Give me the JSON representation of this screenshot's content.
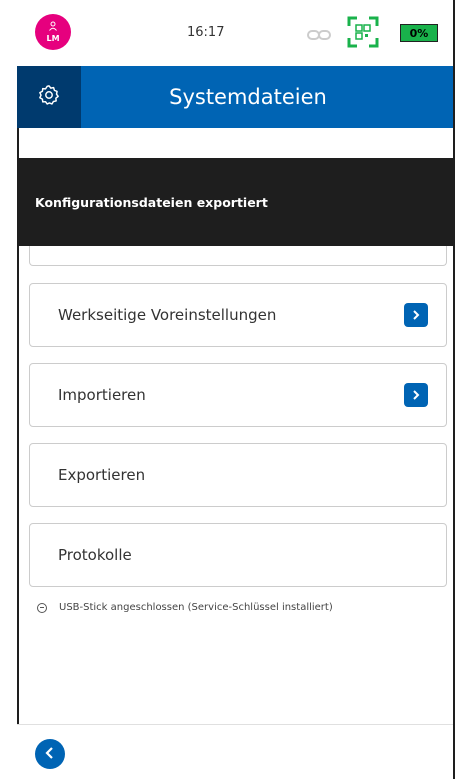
{
  "status_bar": {
    "avatar_label": "LM",
    "time": "16:17",
    "battery": "0%",
    "icons": [
      "link-icon",
      "qr-scan-icon",
      "battery-icon"
    ]
  },
  "header": {
    "title": "Systemdateien",
    "settings_icon": "gear-icon"
  },
  "toast": {
    "message": "Konfigurationsdateien exportiert"
  },
  "menu": {
    "items": [
      {
        "label": "Werkseitige Voreinstellungen",
        "has_chevron": true
      },
      {
        "label": "Importieren",
        "has_chevron": true
      },
      {
        "label": "Exportieren",
        "has_chevron": false
      },
      {
        "label": "Protokolle",
        "has_chevron": false
      }
    ]
  },
  "info": {
    "text": "USB-Stick angeschlossen (Service-Schlüssel installiert)"
  },
  "colors": {
    "primary": "#0064b4",
    "header_dark": "#003a6e",
    "avatar": "#e6007e",
    "battery": "#19b24b",
    "toast_bg": "#1e1e1e"
  }
}
